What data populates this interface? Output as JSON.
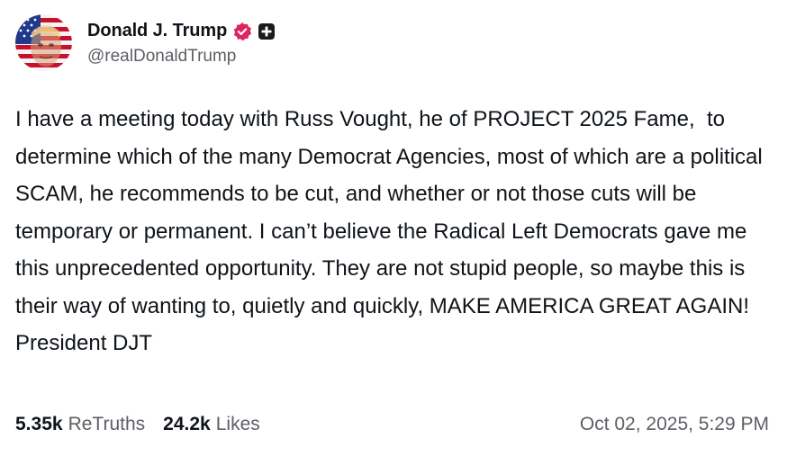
{
  "author": {
    "display_name": "Donald J. Trump",
    "handle": "@realDonaldTrump",
    "avatar_icon": "flag-portrait-avatar",
    "verified_icon": "verified-badge-icon",
    "verified_color": "#e0245e",
    "plus_icon": "plus-badge-icon"
  },
  "post": {
    "text": "I have a meeting today with Russ Vought, he of PROJECT 2025 Fame,  to determine which of the many Democrat Agencies, most of which are a political SCAM, he recommends to be cut, and whether or not those cuts will be temporary or permanent. I can’t believe the Radical Left Democrats gave me this unprecedented opportunity. They are not stupid people, so maybe this is their way of wanting to, quietly and quickly, MAKE AMERICA GREAT AGAIN! President DJT"
  },
  "stats": {
    "retruths_count": "5.35k",
    "retruths_label": "ReTruths",
    "likes_count": "24.2k",
    "likes_label": "Likes"
  },
  "timestamp": "Oct 02, 2025, 5:29 PM",
  "colors": {
    "text_primary": "#0f1419",
    "text_secondary": "#5e5e66",
    "background": "#ffffff"
  }
}
